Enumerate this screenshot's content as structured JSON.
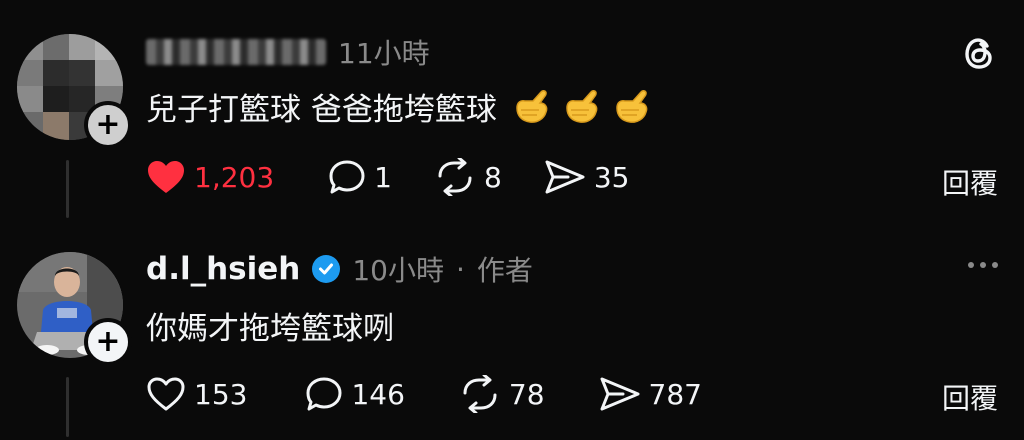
{
  "posts": [
    {
      "author_blurred": true,
      "time": "11小時",
      "text": "兒子打籃球 爸爸拖垮籃球",
      "emoji_icon": "call-me-hand-emoji",
      "emoji_count": 3,
      "likes": "1,203",
      "liked": true,
      "replies": "1",
      "reposts": "8",
      "shares": "35",
      "reply_label": "回覆"
    },
    {
      "author": "d.l_hsieh",
      "verified": true,
      "time": "10小時",
      "separator": "·",
      "author_tag": "作者",
      "text": "你媽才拖垮籃球咧",
      "likes": "153",
      "liked": false,
      "replies": "146",
      "reposts": "78",
      "shares": "787",
      "reply_label": "回覆"
    }
  ],
  "colors": {
    "background": "#0a0a0a",
    "text": "#f3f5f7",
    "muted": "#8a8a8a",
    "like_active": "#ff3040",
    "verified": "#1d9bf0"
  },
  "icons": [
    "threads-logo-icon",
    "heart-icon",
    "comment-icon",
    "repost-icon",
    "share-icon",
    "more-icon",
    "verified-icon",
    "plus-icon"
  ]
}
